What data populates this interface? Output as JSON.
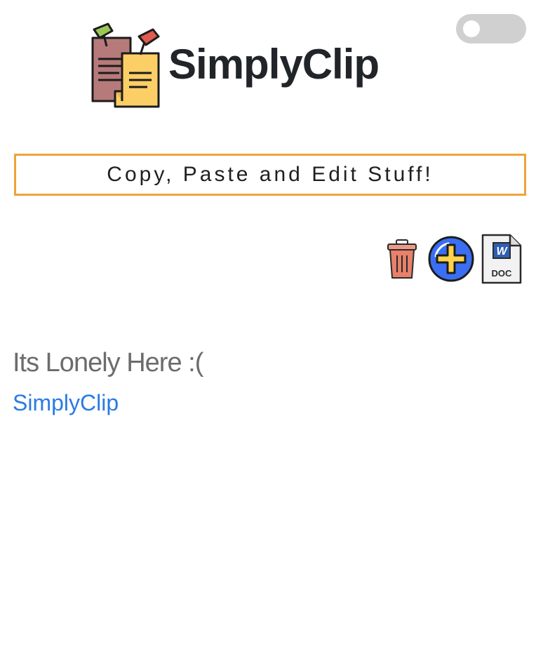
{
  "header": {
    "title": "SimplyClip",
    "logo_icon": "sticky-notes-logo-icon",
    "theme_toggle": {
      "state": "off",
      "icon": "toggle-switch"
    }
  },
  "tagline": "Copy, Paste and Edit Stuff!",
  "toolbar": {
    "clear_icon": "trash-icon",
    "add_icon": "add-icon",
    "export_icon": "word-doc-icon",
    "export_badge": "DOC",
    "export_letter": "W"
  },
  "clips": {
    "empty_message": "Its Lonely Here :(",
    "link_label": "SimplyClip"
  },
  "colors": {
    "tagline_border": "#f0a23a",
    "link": "#2b7ae4",
    "add_button": "#3a6ff3",
    "add_plus": "#ffd34a",
    "trash": "#e8806a"
  }
}
